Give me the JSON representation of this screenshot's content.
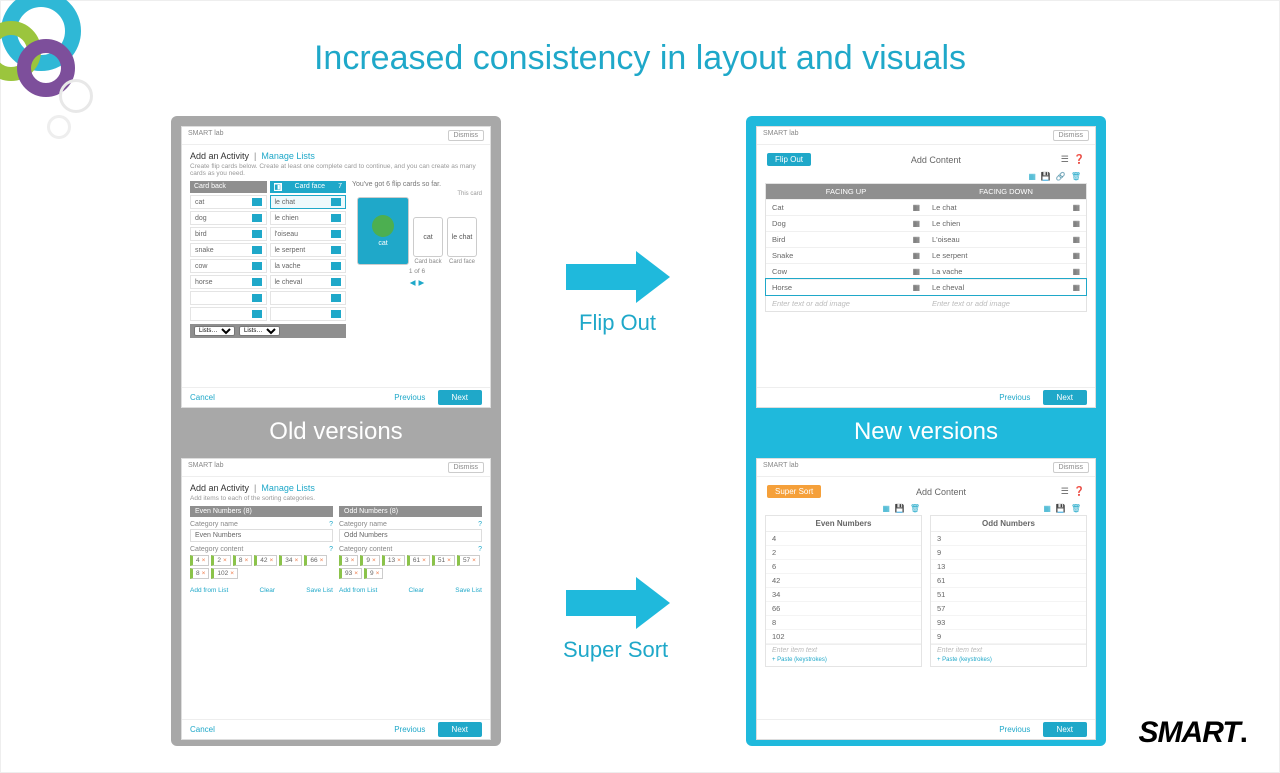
{
  "title": "Increased consistency in layout and visuals",
  "brand": "SMART",
  "panels": {
    "old_label": "Old versions",
    "new_label": "New versions"
  },
  "arrows": {
    "flip_out": "Flip Out",
    "super_sort": "Super Sort"
  },
  "common": {
    "smart_lab": "SMART lab",
    "dismiss": "Dismiss",
    "previous": "Previous",
    "next": "Next",
    "cancel": "Cancel"
  },
  "old_flip": {
    "tab_active": "Add an Activity",
    "tab_link": "Manage Lists",
    "subtext": "Create flip cards below. Create at least one complete card to continue, and you can create as many cards as you need.",
    "col_back": "Card back",
    "col_face": "Card face",
    "count_face": "7",
    "rows": [
      {
        "back": "cat",
        "face": "le chat",
        "sel": true
      },
      {
        "back": "dog",
        "face": "le chien"
      },
      {
        "back": "bird",
        "face": "l'oiseau"
      },
      {
        "back": "snake",
        "face": "le serpent"
      },
      {
        "back": "cow",
        "face": "la vache"
      },
      {
        "back": "horse",
        "face": "le cheval"
      }
    ],
    "lists_label": "Lists…",
    "preview_title": "You've got 6 flip cards so far.",
    "this_card": "This card",
    "big_card": "cat",
    "sm1": "cat",
    "sm2": "le chat",
    "lbl_back": "Card back",
    "lbl_face": "Card face",
    "counter": "1 of 6"
  },
  "old_sort": {
    "tab_active": "Add an Activity",
    "tab_link": "Manage Lists",
    "subtext": "Add items to each of the sorting categories.",
    "cat1_hdr": "Even Numbers  (8)",
    "cat2_hdr": "Odd Numbers  (8)",
    "category_name": "Category name",
    "category_content": "Category content",
    "cat1_name": "Even Numbers",
    "cat2_name": "Odd Numbers",
    "cat1_items": [
      "4",
      "2",
      "8",
      "42",
      "34",
      "66",
      "8",
      "102"
    ],
    "cat2_items": [
      "3",
      "9",
      "13",
      "61",
      "51",
      "57",
      "93",
      "9"
    ],
    "add_from_list": "Add from List",
    "clear": "Clear",
    "save_list": "Save List"
  },
  "new_flip": {
    "badge": "Flip Out",
    "add_content": "Add Content",
    "head_up": "FACING UP",
    "head_down": "FACING DOWN",
    "rows": [
      {
        "up": "Cat",
        "down": "Le chat"
      },
      {
        "up": "Dog",
        "down": "Le chien"
      },
      {
        "up": "Bird",
        "down": "L'oiseau"
      },
      {
        "up": "Snake",
        "down": "Le serpent"
      },
      {
        "up": "Cow",
        "down": "La vache"
      },
      {
        "up": "Horse",
        "down": "Le cheval",
        "sel": true
      }
    ],
    "ph_left": "Enter text or add image",
    "ph_right": "Enter text or add image"
  },
  "new_sort": {
    "badge": "Super Sort",
    "add_content": "Add Content",
    "col1_h": "Even Numbers",
    "col2_h": "Odd Numbers",
    "col1": [
      "4",
      "2",
      "6",
      "42",
      "34",
      "66",
      "8",
      "102"
    ],
    "col2": [
      "3",
      "9",
      "13",
      "61",
      "51",
      "57",
      "93",
      "9"
    ],
    "enter_ph": "Enter item text",
    "paste": "+ Paste (keystrokes)"
  }
}
